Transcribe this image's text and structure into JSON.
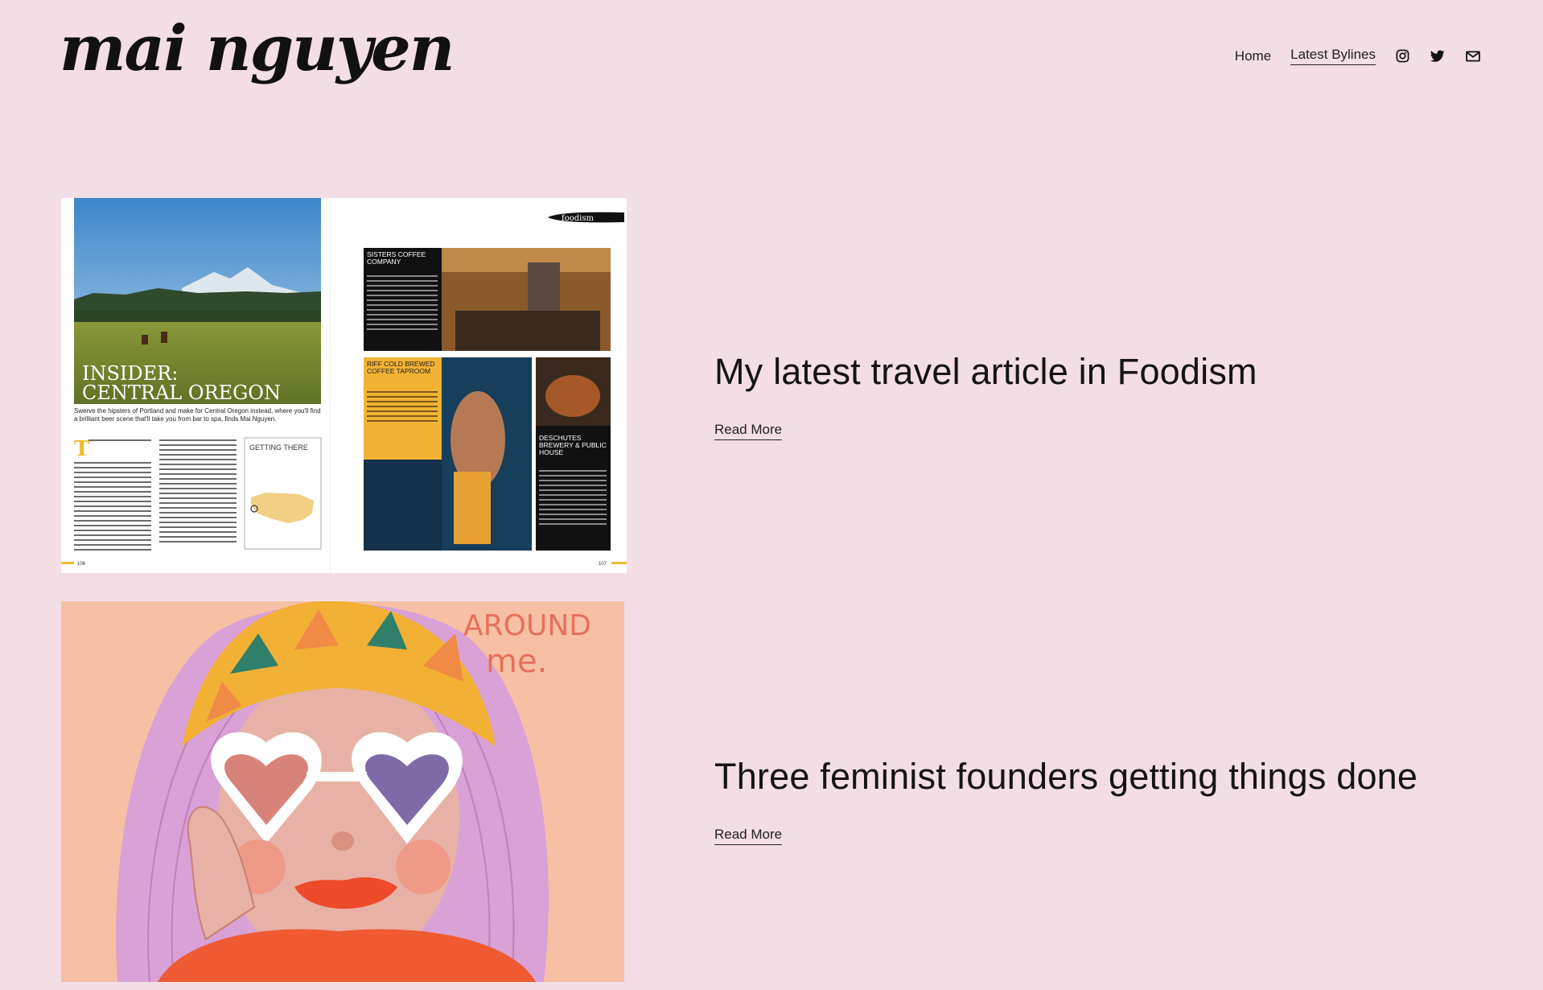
{
  "site": {
    "logo_text": "mai nguyen"
  },
  "nav": {
    "items": [
      {
        "label": "Home"
      },
      {
        "label": "Latest Bylines"
      }
    ],
    "icons": [
      "instagram-icon",
      "twitter-icon",
      "email-icon"
    ]
  },
  "colors": {
    "background": "#f2dee4",
    "text": "#141414"
  },
  "posts": [
    {
      "title": "My latest travel article in Foodism",
      "read_more": "Read More",
      "image": {
        "magazine": "foodism",
        "headline_line1": "INSIDER:",
        "headline_line2": "CENTRAL OREGON",
        "standfirst": "Swerve the hipsters of Portland and make for Central Oregon instead, where you'll find a brilliant beer scene that'll take you from bar to spa, finds Mai Nguyen.",
        "box_getting_there": "GETTING THERE",
        "box1_title": "SISTERS COFFEE COMPANY",
        "box2_title": "RIFF COLD BREWED COFFEE TAPROOM",
        "box3_title": "DESCHUTES BREWERY & PUBLIC HOUSE",
        "page_left": "106",
        "page_right": "107"
      }
    },
    {
      "title": "Three feminist founders getting things done",
      "read_more": "Read More",
      "image": {
        "lettering_line1": "AROUND",
        "lettering_line2": "me."
      }
    }
  ]
}
